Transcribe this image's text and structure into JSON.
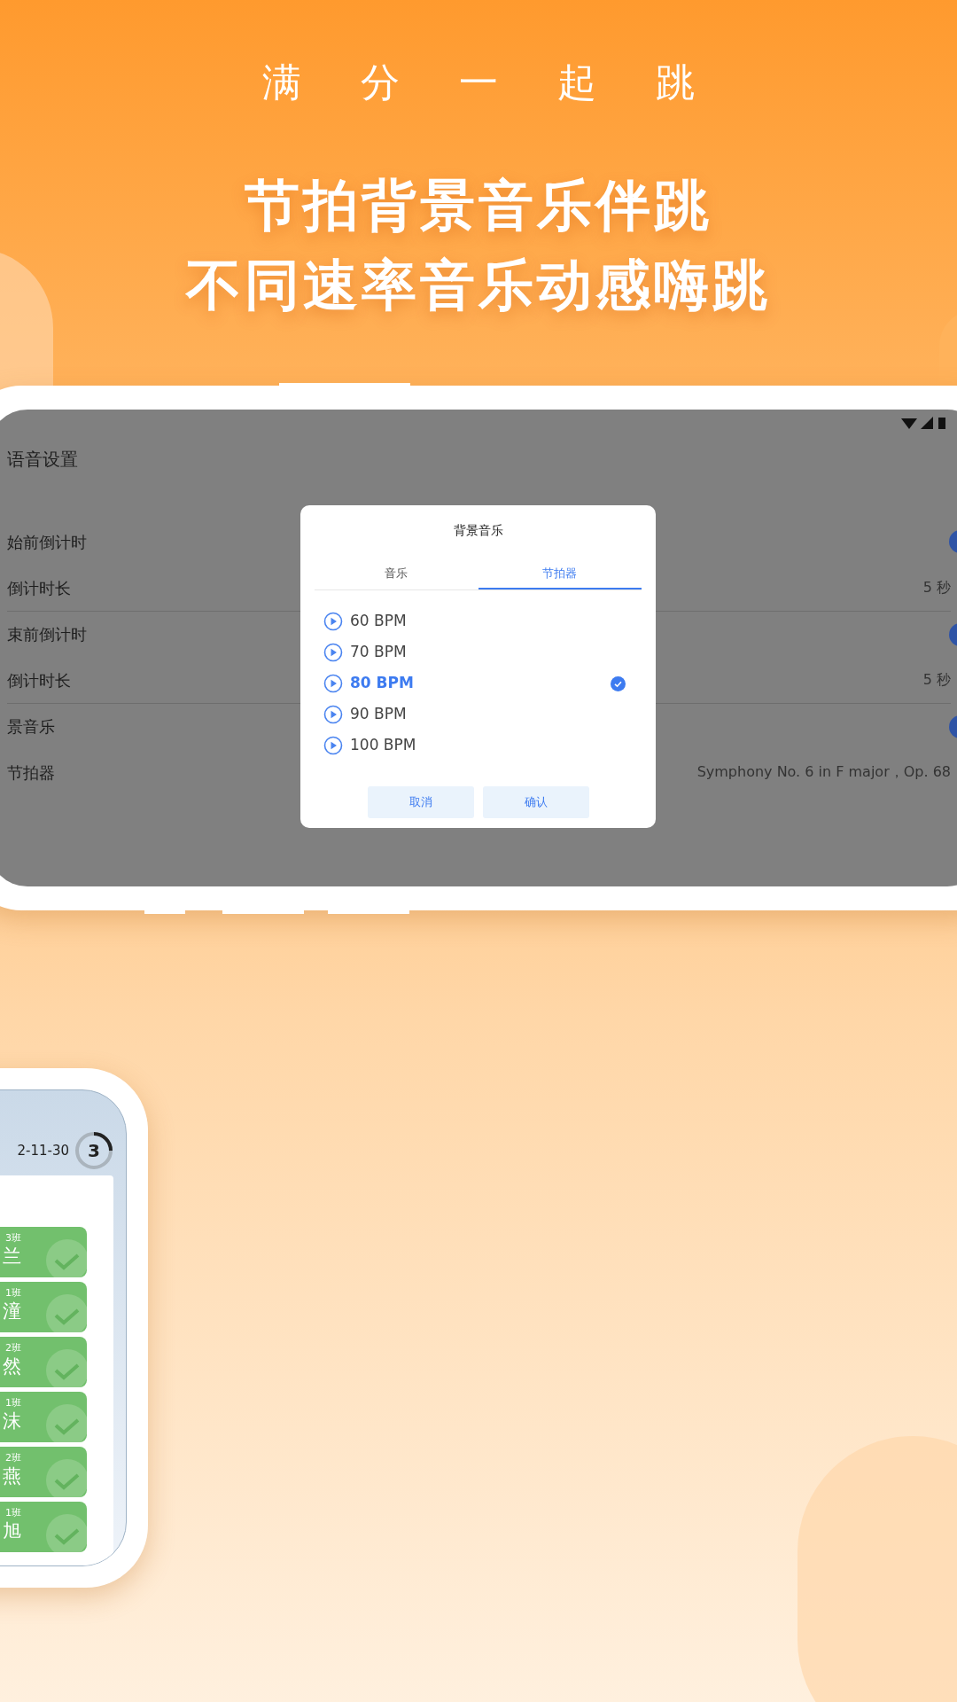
{
  "slogan": "满 分 一 起 跳",
  "headline": [
    "节拍背景音乐伴跳",
    "不同速率音乐动感嗨跳"
  ],
  "settings_screen": {
    "title": "语音设置",
    "rows": [
      {
        "kind": "toggle",
        "label": "始前倒计时",
        "on": true
      },
      {
        "kind": "value",
        "label": "倒计时长",
        "value": "5 秒"
      },
      {
        "kind": "toggle",
        "label": "束前倒计时",
        "on": true
      },
      {
        "kind": "value",
        "label": "倒计时长",
        "value": "5 秒"
      },
      {
        "kind": "toggle",
        "label": "景音乐",
        "on": true
      },
      {
        "kind": "value",
        "label": "节拍器",
        "value": "Symphony No. 6 in F major，Op. 68"
      }
    ],
    "dialog": {
      "title": "背景音乐",
      "tabs": [
        {
          "label": "音乐",
          "selected": false
        },
        {
          "label": "节拍器",
          "selected": true
        }
      ],
      "options": [
        {
          "label": "60 BPM",
          "selected": false
        },
        {
          "label": "70 BPM",
          "selected": false
        },
        {
          "label": "80 BPM",
          "selected": true
        },
        {
          "label": "90 BPM",
          "selected": false
        },
        {
          "label": "100 BPM",
          "selected": false
        }
      ],
      "buttons": [
        "取消",
        "确认"
      ]
    }
  },
  "list_screen": {
    "date": "2-11-30",
    "countdown": "3",
    "cards": [
      {
        "class": "3班",
        "name": "兰",
        "checked": true
      },
      {
        "class": "1班",
        "name": "潼",
        "checked": true
      },
      {
        "class": "2班",
        "name": "然",
        "checked": true
      },
      {
        "class": "1班",
        "name": "沫",
        "checked": true
      },
      {
        "class": "2班",
        "name": "燕",
        "checked": true
      },
      {
        "class": "1班",
        "name": "旭",
        "checked": true
      }
    ]
  }
}
